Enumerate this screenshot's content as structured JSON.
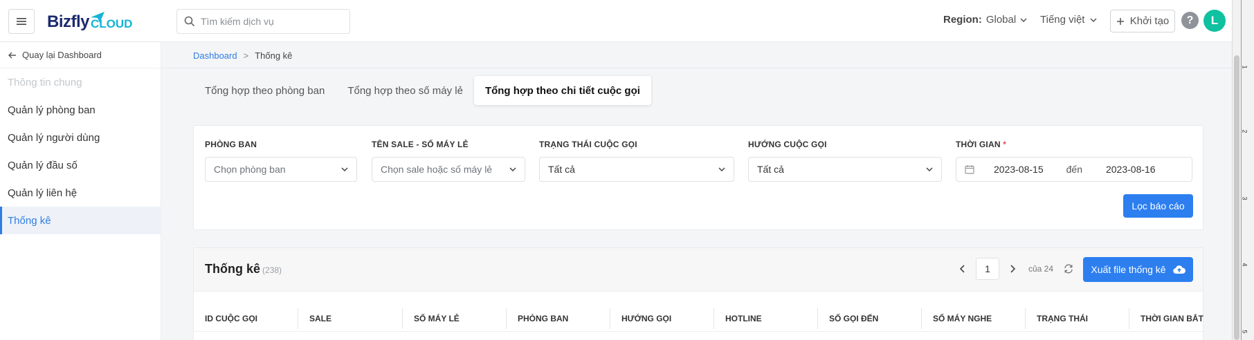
{
  "header": {
    "logo_main": "Bizfly",
    "logo_sub": "CLOUD",
    "search_placeholder": "Tìm kiếm dịch vụ",
    "region_label": "Region:",
    "region_value": "Global",
    "language": "Tiếng việt",
    "create_label": "Khởi tạo",
    "help_label": "?",
    "avatar_initial": "L"
  },
  "sidebar": {
    "back_label": "Quay lại Dashboard",
    "items": [
      {
        "label": "Thông tin chung"
      },
      {
        "label": "Quản lý phòng ban"
      },
      {
        "label": "Quản lý người dùng"
      },
      {
        "label": "Quản lý đầu số"
      },
      {
        "label": "Quản lý liên hệ"
      },
      {
        "label": "Thống kê"
      }
    ]
  },
  "breadcrumb": {
    "root": "Dashboard",
    "separator": ">",
    "current": "Thống kê"
  },
  "tabs": [
    {
      "label": "Tổng hợp theo phòng ban"
    },
    {
      "label": "Tổng hợp theo số máy lẻ"
    },
    {
      "label": "Tổng hợp theo chi tiết cuộc gọi"
    }
  ],
  "filters": {
    "department": {
      "label": "PHÒNG BAN",
      "placeholder": "Chọn phòng ban"
    },
    "sale": {
      "label": "TÊN SALE - SỐ MÁY LẺ",
      "placeholder": "Chọn sale hoặc số máy lẻ"
    },
    "status": {
      "label": "TRẠNG THÁI CUỘC GỌI",
      "value": "Tất cả"
    },
    "direction": {
      "label": "HƯỚNG CUỘC GỌI",
      "value": "Tất cả"
    },
    "time": {
      "label": "THỜI GIAN",
      "required": "*",
      "from": "2023-08-15",
      "to_label": "đến",
      "to": "2023-08-16"
    },
    "submit_label": "Lọc báo cáo"
  },
  "stats": {
    "title": "Thống kê",
    "count": "(238)",
    "page": "1",
    "of_pages": "của 24",
    "export_label": "Xuất file thống kê",
    "columns": [
      "ID CUỘC GỌI",
      "SALE",
      "SỐ MÁY LẺ",
      "PHÒNG BAN",
      "HƯỚNG GỌI",
      "HOTLINE",
      "SỐ GỌI ĐẾN",
      "SỐ MÁY NGHE",
      "TRẠNG THÁI",
      "THỜI GIAN BẮT"
    ]
  },
  "ruler": {
    "labels": [
      "1",
      "2",
      "3",
      "4",
      "5"
    ]
  },
  "colors": {
    "accent": "#2d7ff0",
    "avatar": "#10c1a0",
    "brand_dark": "#1d2a6e",
    "brand_light": "#14b4d6"
  }
}
